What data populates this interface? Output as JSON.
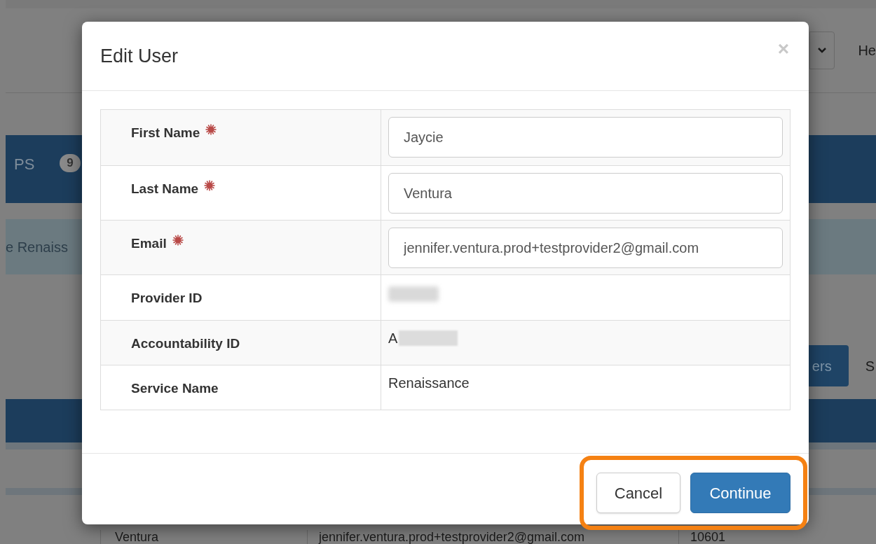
{
  "background": {
    "select_text": "He",
    "tab_bar": {
      "label": "PS",
      "badge": "9"
    },
    "banner_text": "e Renaiss",
    "button_label": "ers",
    "side_text": "S",
    "row": [
      "Ventura",
      "jennifer.ventura.prod+testprovider2@gmail.com",
      "10601"
    ]
  },
  "dialog": {
    "title": "Edit User",
    "close": "×",
    "fields": [
      {
        "label": "First Name",
        "required": true,
        "kind": "input",
        "value": "Jaycie"
      },
      {
        "label": "Last Name",
        "required": true,
        "kind": "input",
        "value": "Ventura"
      },
      {
        "label": "Email",
        "required": true,
        "kind": "input",
        "value": "jennifer.ventura.prod+testprovider2@gmail.com"
      },
      {
        "label": "Provider ID",
        "required": false,
        "kind": "redacted"
      },
      {
        "label": "Accountability ID",
        "required": false,
        "kind": "partial",
        "value": "A"
      },
      {
        "label": "Service Name",
        "required": false,
        "kind": "text",
        "value": "Renaissance"
      }
    ],
    "buttons": [
      {
        "label": "Cancel",
        "kind": "default"
      },
      {
        "label": "Continue",
        "kind": "primary"
      }
    ],
    "highlight": true
  }
}
